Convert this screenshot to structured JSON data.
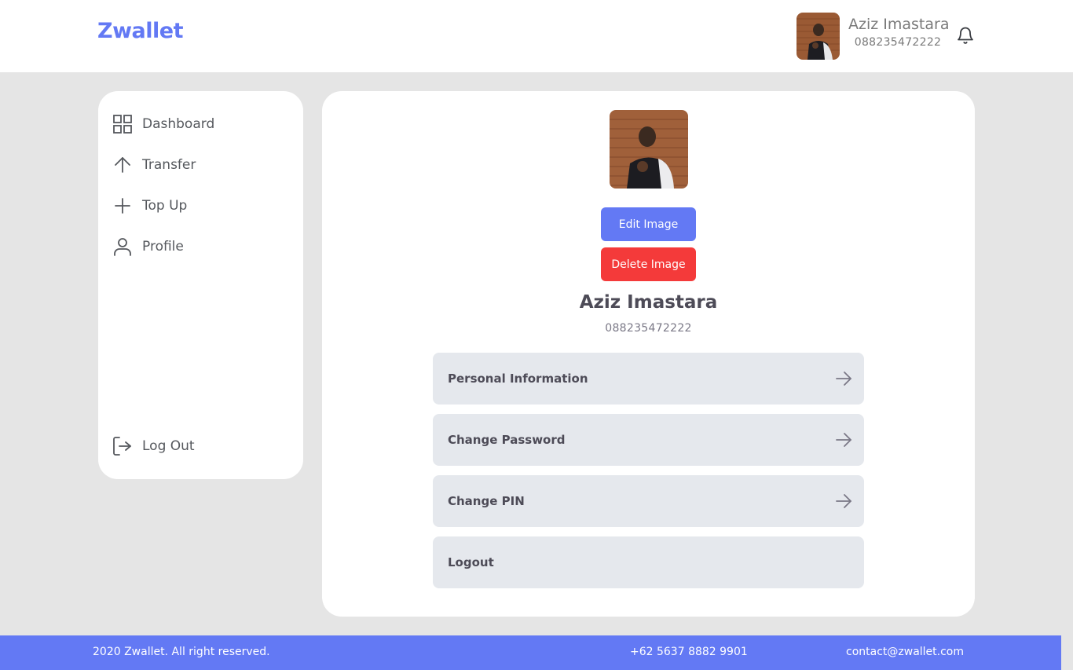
{
  "header": {
    "logo": "Zwallet",
    "user_name": "Aziz Imastara",
    "user_phone": "088235472222"
  },
  "sidebar": {
    "items": [
      {
        "label": "Dashboard",
        "icon": "grid-icon"
      },
      {
        "label": "Transfer",
        "icon": "arrow-up-icon"
      },
      {
        "label": "Top Up",
        "icon": "plus-icon"
      },
      {
        "label": "Profile",
        "icon": "user-icon"
      }
    ],
    "logout_label": "Log Out"
  },
  "profile": {
    "edit_image_label": "Edit Image",
    "delete_image_label": "Delete Image",
    "name": "Aziz Imastara",
    "phone": "088235472222",
    "menu": [
      {
        "label": "Personal Information"
      },
      {
        "label": "Change Password"
      },
      {
        "label": "Change PIN"
      },
      {
        "label": "Logout"
      }
    ]
  },
  "footer": {
    "copyright": "2020 Zwallet. All right reserved.",
    "phone": "+62 5637 8882 9901",
    "email": "contact@zwallet.com"
  },
  "colors": {
    "primary": "#6379f4",
    "danger": "#f43a3a",
    "background": "#e5e5e5",
    "menu_bg": "#e5e8ed"
  }
}
